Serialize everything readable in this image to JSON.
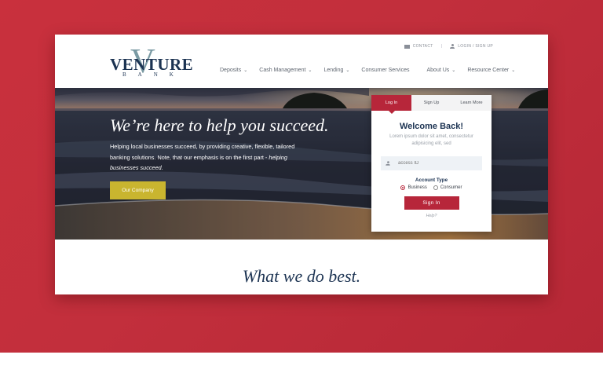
{
  "brand": {
    "name": "VENTURE",
    "sub": "BANK",
    "monogram": "V"
  },
  "util": {
    "contact": "CONTACT",
    "separator": "|",
    "login": "LOGIN / SIGN UP"
  },
  "nav": [
    {
      "label": "Deposits",
      "has_menu": true
    },
    {
      "label": "Cash Management",
      "has_menu": true
    },
    {
      "label": "Lending",
      "has_menu": true
    },
    {
      "label": "Consumer Services",
      "has_menu": false
    },
    {
      "label": "About Us",
      "has_menu": true
    },
    {
      "label": "Resource Center",
      "has_menu": true
    }
  ],
  "hero": {
    "headline": "We’re here to help you succeed.",
    "sub_plain": "Helping local businesses succeed, by providing creative, flexible, tailored banking solutions. Note, that our emphasis is on the first part - ",
    "sub_em": "helping businesses succeed.",
    "cta": "Our Company"
  },
  "login": {
    "tabs": [
      "Log In",
      "Sign Up",
      "Learn More"
    ],
    "active_tab": "Log In",
    "title": "Welcome Back!",
    "lorem": "Lorem ipsum dolor sit amet, consectetur adipisicing elit, sed",
    "input_placeholder": "access ID",
    "account_type_label": "Account Type",
    "options": [
      "Business",
      "Consumer"
    ],
    "selected": "Business",
    "button": "Sign In",
    "help": "Help?"
  },
  "section_title": "What we do best.",
  "colors": {
    "brand_red": "#b7263a",
    "navy": "#1c3352",
    "cta_yellow": "#c9b52f",
    "background_red": "#c22f3c"
  },
  "icons": [
    "envelope-icon",
    "user-icon",
    "chevron-down-icon"
  ]
}
